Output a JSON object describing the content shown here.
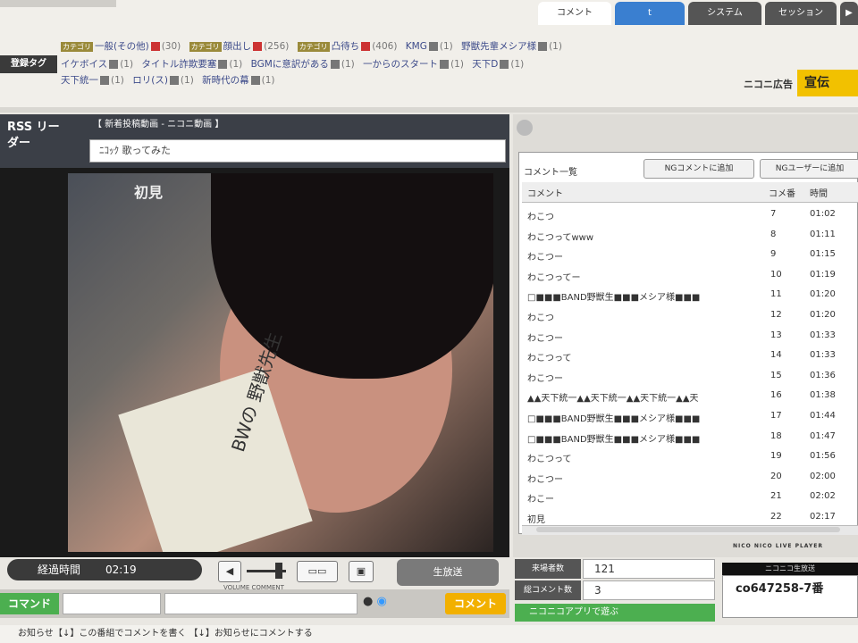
{
  "header": {
    "tag_label": "登録タグ",
    "tags_row1": [
      {
        "lock": "カテゴリ",
        "name": "一般(その他)",
        "count": "(30)",
        "icon": "red"
      },
      {
        "lock": "カテゴリ",
        "name": "顔出し",
        "count": "(256)",
        "icon": "red"
      },
      {
        "lock": "カテゴリ",
        "name": "凸待ち",
        "count": "(406)",
        "icon": "red"
      },
      {
        "lock": "",
        "name": "KMG",
        "count": "(1)",
        "icon": "grey"
      },
      {
        "lock": "",
        "name": "野獣先輩メシア様",
        "count": "(1)",
        "icon": "grey"
      }
    ],
    "tags_row2": [
      {
        "name": "イケボイス",
        "count": "(1)"
      },
      {
        "name": "タイトル詐欺要塞",
        "count": "(1)"
      },
      {
        "name": "BGMに意訳がある",
        "count": "(1)"
      },
      {
        "name": "一からのスタート",
        "count": "(1)"
      },
      {
        "name": "天下D",
        "count": "(1)"
      }
    ],
    "tags_row3": [
      {
        "name": "天下統一",
        "count": "(1)"
      },
      {
        "name": "ロリ(ス)",
        "count": "(1)"
      },
      {
        "name": "新時代の幕",
        "count": "(1)"
      }
    ],
    "nico_logo": "ニコニ広告",
    "ad_badge": "宣伝"
  },
  "player": {
    "rss_label": "RSS リーダー",
    "community": "【 新着投稿動画 - ニコニ動画 】",
    "title": "ﾆｺｯｸ 歌ってみた",
    "video_overlay": "初見",
    "card_text": "BWの 野獣先生",
    "elapsed_label": "経過時間",
    "elapsed_time": "02:19",
    "big_button": "生放送",
    "sub_labels": "VOLUME    COMMENT",
    "command_button": "コマンド",
    "comment_button": "コメント"
  },
  "right_panel": {
    "tabs": [
      "コメント",
      "t",
      "システム",
      "セッション",
      "▶"
    ],
    "list_title": "コメント一覧",
    "ng_comment_btn": "NGコメントに追加",
    "ng_user_btn": "NGユーザーに追加",
    "columns": [
      "コメント",
      "コメ番",
      "時間"
    ],
    "comments": [
      {
        "text": "わこつ",
        "no": "7",
        "time": "01:02"
      },
      {
        "text": "わこつってwww",
        "no": "8",
        "time": "01:11"
      },
      {
        "text": "わこつー",
        "no": "9",
        "time": "01:15"
      },
      {
        "text": "わこつってー",
        "no": "10",
        "time": "01:19"
      },
      {
        "text": "□■■■BAND野獣生■■■メシア様■■■",
        "no": "11",
        "time": "01:20"
      },
      {
        "text": "わこつ",
        "no": "12",
        "time": "01:20"
      },
      {
        "text": "わこつー",
        "no": "13",
        "time": "01:33"
      },
      {
        "text": "わこつって",
        "no": "14",
        "time": "01:33"
      },
      {
        "text": "わこつー",
        "no": "15",
        "time": "01:36"
      },
      {
        "text": "▲▲天下統一▲▲天下統一▲▲天下統一▲▲天",
        "no": "16",
        "time": "01:38"
      },
      {
        "text": "□■■■BAND野獣生■■■メシア様■■■",
        "no": "17",
        "time": "01:44"
      },
      {
        "text": "□■■■BAND野獣生■■■メシア様■■■",
        "no": "18",
        "time": "01:47"
      },
      {
        "text": "わこつって",
        "no": "19",
        "time": "01:56"
      },
      {
        "text": "わこつー",
        "no": "20",
        "time": "02:00"
      },
      {
        "text": "わこー",
        "no": "21",
        "time": "02:02"
      },
      {
        "text": "初見",
        "no": "22",
        "time": "02:17"
      }
    ],
    "live_tag": "NICO NICO LIVE PLAYER"
  },
  "stats": {
    "visitors_label": "来場者数",
    "visitors": "121",
    "comments_label": "総コメント数",
    "comments": "3",
    "community_btn": "ニコニコアプリで遊ぶ",
    "ad_top": "ニコニコ生放送",
    "community_id": "co647258-7番"
  },
  "status_bar": {
    "label": "お知らせ",
    "message": "【↓】この番組でコメントを書く 【↓】お知らせにコメントする"
  }
}
